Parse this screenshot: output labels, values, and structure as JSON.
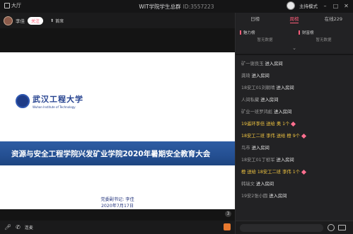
{
  "titlebar": {
    "back_label": "大厅",
    "title": "WIT学院学生总群",
    "id_label": "ID:3557223",
    "host_mode_label": "主持模式"
  },
  "host": {
    "name": "李佳",
    "follow_label": "关注",
    "share_label": "首席"
  },
  "slide": {
    "logo_cn": "武汉工程大学",
    "logo_en": "Wuhan Institute of Technology",
    "banner": "资源与安全工程学院兴发矿业学院2020年暑期安全教育大会",
    "presenter": "党委副书记: 李佳",
    "date": "2020年7月17日"
  },
  "stage_badge": "3",
  "bottombar": {
    "mic_label": "连麦"
  },
  "right": {
    "tabs": [
      "日榜",
      "周榜",
      "在线229"
    ],
    "rank_cols": [
      "魅力榜",
      "财富榜"
    ],
    "rank_empty": [
      "暂无数据",
      "暂无数据"
    ],
    "messages": [
      {
        "name": "矿一谢良玉",
        "text": "进入房间",
        "gold": false
      },
      {
        "name": "龚琦",
        "text": "进入房间",
        "gold": false
      },
      {
        "name": "18安工01刘朝晴",
        "text": "进入房间",
        "gold": false
      },
      {
        "name": "人间私藏",
        "text": "进入房间",
        "gold": false
      },
      {
        "name": "矿业一班罗鸿彪",
        "text": "进入房间",
        "gold": false
      },
      {
        "name": "19遥环李倍",
        "text": "送给 奥 1个",
        "gold": true
      },
      {
        "name": "18安工二班 李伟",
        "text": "送给 橙 9个",
        "gold": true
      },
      {
        "name": "鸟市",
        "text": "进入房间",
        "gold": false
      },
      {
        "name": "18安工01丁桢军",
        "text": "进入房间",
        "gold": false
      },
      {
        "name": "橙",
        "text": "送给 18安工二班 李伟 1个",
        "gold": true
      },
      {
        "name": "韩瑞文",
        "text": "进入房间",
        "gold": false
      },
      {
        "name": "19安2张小圆",
        "text": "进入房间",
        "gold": false
      }
    ],
    "input_placeholder": ""
  },
  "colors": {
    "accent": "#ff5d7a",
    "gold": "#f1c541",
    "banner": "#2e5da3"
  }
}
